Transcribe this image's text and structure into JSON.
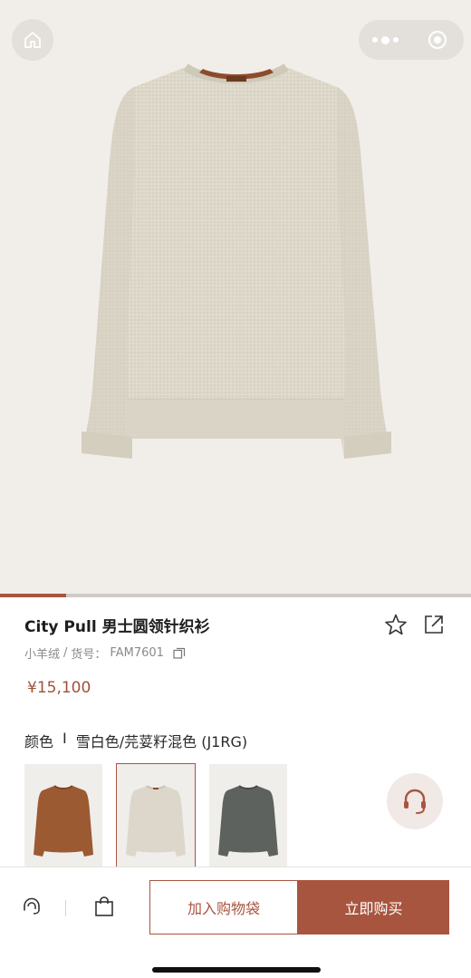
{
  "product": {
    "title": "City Pull 男士圆领针织衫",
    "material": "小羊绒",
    "separator": "/",
    "sku_label": "货号：",
    "sku": "FAM7601",
    "price": "¥15,100",
    "color_label": "颜色",
    "color_sep": "I",
    "color_value": "雪白色/芫荽籽混色 (J1RG)"
  },
  "gallery": {
    "progress_fraction": 0.14
  },
  "swatches": [
    {
      "name": "brown",
      "color": "#9c5a32"
    },
    {
      "name": "cream",
      "color": "#ddd7cb",
      "selected": true
    },
    {
      "name": "grey",
      "color": "#5e625f"
    }
  ],
  "actions": {
    "add_to_bag": "加入购物袋",
    "buy_now": "立即购买"
  },
  "icons": {
    "home": "home-icon",
    "more": "more-dots-icon",
    "close": "close-target-icon",
    "favorite": "star-icon",
    "share": "share-icon",
    "copy": "copy-icon",
    "service": "customer-service-icon",
    "bag": "shopping-bag-icon"
  },
  "colors": {
    "accent": "#a8553f",
    "background": "#f1eeea",
    "sweater": "#ddd8ca"
  }
}
